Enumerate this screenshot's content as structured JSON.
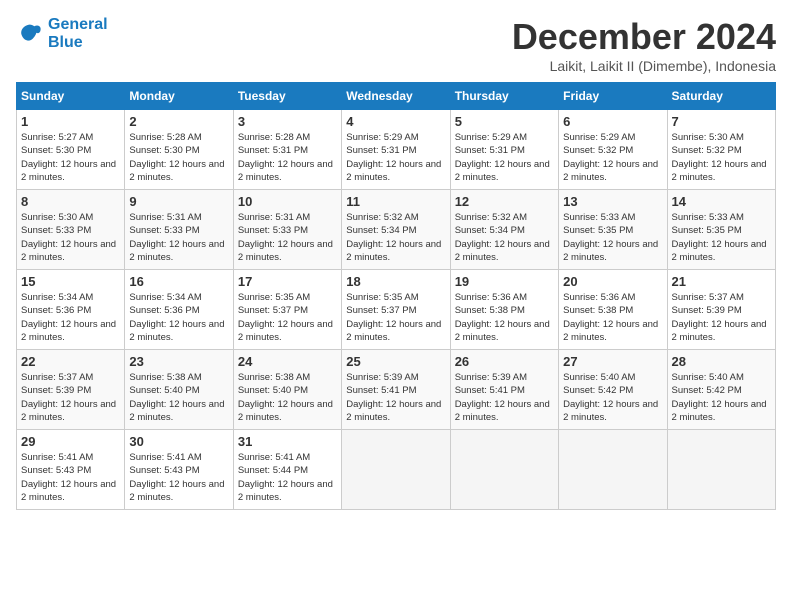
{
  "logo": {
    "line1": "General",
    "line2": "Blue"
  },
  "title": "December 2024",
  "location": "Laikit, Laikit II (Dimembe), Indonesia",
  "days_of_week": [
    "Sunday",
    "Monday",
    "Tuesday",
    "Wednesday",
    "Thursday",
    "Friday",
    "Saturday"
  ],
  "weeks": [
    [
      {
        "day": 1,
        "sunrise": "5:27 AM",
        "sunset": "5:30 PM",
        "daylight": "12 hours and 2 minutes."
      },
      {
        "day": 2,
        "sunrise": "5:28 AM",
        "sunset": "5:30 PM",
        "daylight": "12 hours and 2 minutes."
      },
      {
        "day": 3,
        "sunrise": "5:28 AM",
        "sunset": "5:31 PM",
        "daylight": "12 hours and 2 minutes."
      },
      {
        "day": 4,
        "sunrise": "5:29 AM",
        "sunset": "5:31 PM",
        "daylight": "12 hours and 2 minutes."
      },
      {
        "day": 5,
        "sunrise": "5:29 AM",
        "sunset": "5:31 PM",
        "daylight": "12 hours and 2 minutes."
      },
      {
        "day": 6,
        "sunrise": "5:29 AM",
        "sunset": "5:32 PM",
        "daylight": "12 hours and 2 minutes."
      },
      {
        "day": 7,
        "sunrise": "5:30 AM",
        "sunset": "5:32 PM",
        "daylight": "12 hours and 2 minutes."
      }
    ],
    [
      {
        "day": 8,
        "sunrise": "5:30 AM",
        "sunset": "5:33 PM",
        "daylight": "12 hours and 2 minutes."
      },
      {
        "day": 9,
        "sunrise": "5:31 AM",
        "sunset": "5:33 PM",
        "daylight": "12 hours and 2 minutes."
      },
      {
        "day": 10,
        "sunrise": "5:31 AM",
        "sunset": "5:33 PM",
        "daylight": "12 hours and 2 minutes."
      },
      {
        "day": 11,
        "sunrise": "5:32 AM",
        "sunset": "5:34 PM",
        "daylight": "12 hours and 2 minutes."
      },
      {
        "day": 12,
        "sunrise": "5:32 AM",
        "sunset": "5:34 PM",
        "daylight": "12 hours and 2 minutes."
      },
      {
        "day": 13,
        "sunrise": "5:33 AM",
        "sunset": "5:35 PM",
        "daylight": "12 hours and 2 minutes."
      },
      {
        "day": 14,
        "sunrise": "5:33 AM",
        "sunset": "5:35 PM",
        "daylight": "12 hours and 2 minutes."
      }
    ],
    [
      {
        "day": 15,
        "sunrise": "5:34 AM",
        "sunset": "5:36 PM",
        "daylight": "12 hours and 2 minutes."
      },
      {
        "day": 16,
        "sunrise": "5:34 AM",
        "sunset": "5:36 PM",
        "daylight": "12 hours and 2 minutes."
      },
      {
        "day": 17,
        "sunrise": "5:35 AM",
        "sunset": "5:37 PM",
        "daylight": "12 hours and 2 minutes."
      },
      {
        "day": 18,
        "sunrise": "5:35 AM",
        "sunset": "5:37 PM",
        "daylight": "12 hours and 2 minutes."
      },
      {
        "day": 19,
        "sunrise": "5:36 AM",
        "sunset": "5:38 PM",
        "daylight": "12 hours and 2 minutes."
      },
      {
        "day": 20,
        "sunrise": "5:36 AM",
        "sunset": "5:38 PM",
        "daylight": "12 hours and 2 minutes."
      },
      {
        "day": 21,
        "sunrise": "5:37 AM",
        "sunset": "5:39 PM",
        "daylight": "12 hours and 2 minutes."
      }
    ],
    [
      {
        "day": 22,
        "sunrise": "5:37 AM",
        "sunset": "5:39 PM",
        "daylight": "12 hours and 2 minutes."
      },
      {
        "day": 23,
        "sunrise": "5:38 AM",
        "sunset": "5:40 PM",
        "daylight": "12 hours and 2 minutes."
      },
      {
        "day": 24,
        "sunrise": "5:38 AM",
        "sunset": "5:40 PM",
        "daylight": "12 hours and 2 minutes."
      },
      {
        "day": 25,
        "sunrise": "5:39 AM",
        "sunset": "5:41 PM",
        "daylight": "12 hours and 2 minutes."
      },
      {
        "day": 26,
        "sunrise": "5:39 AM",
        "sunset": "5:41 PM",
        "daylight": "12 hours and 2 minutes."
      },
      {
        "day": 27,
        "sunrise": "5:40 AM",
        "sunset": "5:42 PM",
        "daylight": "12 hours and 2 minutes."
      },
      {
        "day": 28,
        "sunrise": "5:40 AM",
        "sunset": "5:42 PM",
        "daylight": "12 hours and 2 minutes."
      }
    ],
    [
      {
        "day": 29,
        "sunrise": "5:41 AM",
        "sunset": "5:43 PM",
        "daylight": "12 hours and 2 minutes."
      },
      {
        "day": 30,
        "sunrise": "5:41 AM",
        "sunset": "5:43 PM",
        "daylight": "12 hours and 2 minutes."
      },
      {
        "day": 31,
        "sunrise": "5:41 AM",
        "sunset": "5:44 PM",
        "daylight": "12 hours and 2 minutes."
      },
      null,
      null,
      null,
      null
    ]
  ]
}
